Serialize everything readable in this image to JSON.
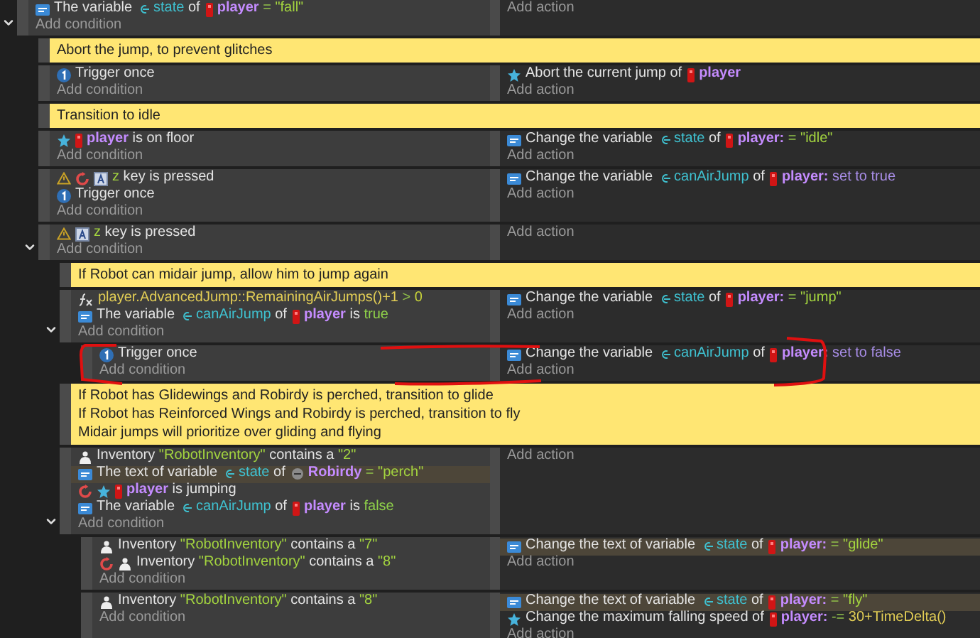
{
  "events": [
    {
      "kind": "event",
      "expanded": true,
      "add_condition": "Add condition",
      "add_action": "Add action",
      "conditions": [
        {
          "icons": [
            {
              "kind": "variable"
            }
          ],
          "highlighted": false,
          "segments": [
            {
              "kind": "text",
              "text": "The variable"
            },
            {
              "kind": "param",
              "text": "state"
            },
            {
              "kind": "text",
              "text": "of"
            },
            {
              "kind": "object",
              "text": "player"
            },
            {
              "kind": "operator",
              "text": "="
            },
            {
              "kind": "string",
              "text": "\"fall\""
            }
          ]
        }
      ],
      "children": [
        {
          "kind": "comment",
          "lines": [
            "Abort the jump, to prevent glitches"
          ]
        },
        {
          "kind": "event",
          "add_condition": "Add condition",
          "add_action": "Add action",
          "conditions": [
            {
              "icons": [
                {
                  "kind": "trigger"
                }
              ],
              "highlighted": false,
              "segments": [
                {
                  "kind": "text",
                  "text": "Trigger once"
                }
              ]
            }
          ],
          "actions": [
            {
              "icons": [
                {
                  "kind": "platformer"
                }
              ],
              "highlighted": false,
              "segments": [
                {
                  "kind": "text",
                  "text": "Abort the current jump of"
                },
                {
                  "kind": "object",
                  "text": "player"
                }
              ]
            }
          ]
        },
        {
          "kind": "comment",
          "lines": [
            "Transition to idle"
          ]
        },
        {
          "kind": "event",
          "add_condition": "Add condition",
          "add_action": "Add action",
          "conditions": [
            {
              "icons": [
                {
                  "kind": "platformer"
                }
              ],
              "highlighted": false,
              "segments": [
                {
                  "kind": "object",
                  "text": "player"
                },
                {
                  "kind": "text",
                  "text": "is on floor"
                }
              ]
            }
          ],
          "actions": [
            {
              "icons": [
                {
                  "kind": "variable"
                }
              ],
              "highlighted": false,
              "segments": [
                {
                  "kind": "text",
                  "text": "Change the variable"
                },
                {
                  "kind": "param",
                  "text": "state"
                },
                {
                  "kind": "text",
                  "text": "of"
                },
                {
                  "kind": "object",
                  "text": "player:"
                },
                {
                  "kind": "operator",
                  "text": "="
                },
                {
                  "kind": "string",
                  "text": "\"idle\""
                }
              ]
            }
          ]
        },
        {
          "kind": "event",
          "add_condition": "Add condition",
          "add_action": "Add action",
          "conditions": [
            {
              "icons": [
                {
                  "kind": "warning"
                },
                {
                  "kind": "inverted"
                },
                {
                  "kind": "keyboard"
                }
              ],
              "highlighted": false,
              "segments": [
                {
                  "kind": "string",
                  "text": "z"
                },
                {
                  "kind": "text",
                  "text": "key is pressed"
                }
              ]
            },
            {
              "icons": [
                {
                  "kind": "trigger"
                }
              ],
              "highlighted": false,
              "segments": [
                {
                  "kind": "text",
                  "text": "Trigger once"
                }
              ]
            }
          ],
          "actions": [
            {
              "icons": [
                {
                  "kind": "variable"
                }
              ],
              "highlighted": false,
              "segments": [
                {
                  "kind": "text",
                  "text": "Change the variable"
                },
                {
                  "kind": "param",
                  "text": "canAirJump"
                },
                {
                  "kind": "text",
                  "text": "of"
                },
                {
                  "kind": "object",
                  "text": "player:"
                },
                {
                  "kind": "keyword",
                  "text": "set to true"
                }
              ]
            }
          ]
        },
        {
          "kind": "event",
          "expanded": true,
          "add_condition": "Add condition",
          "add_action": "Add action",
          "conditions": [
            {
              "icons": [
                {
                  "kind": "warning"
                },
                {
                  "kind": "keyboard"
                }
              ],
              "highlighted": false,
              "segments": [
                {
                  "kind": "string",
                  "text": "z"
                },
                {
                  "kind": "text",
                  "text": "key is pressed"
                }
              ]
            }
          ],
          "children": [
            {
              "kind": "comment",
              "lines": [
                "If Robot can midair jump, allow him to jump again"
              ]
            },
            {
              "kind": "event",
              "expanded": true,
              "add_condition": "Add condition",
              "add_action": "Add action",
              "conditions": [
                {
                  "icons": [
                    {
                      "kind": "expression"
                    }
                  ],
                  "highlighted": false,
                  "segments": [
                    {
                      "kind": "expression",
                      "text": "player.AdvancedJump::RemainingAirJumps()+1"
                    },
                    {
                      "kind": "operator",
                      "text": ">"
                    },
                    {
                      "kind": "number",
                      "text": "0"
                    }
                  ]
                },
                {
                  "icons": [
                    {
                      "kind": "variable"
                    }
                  ],
                  "highlighted": false,
                  "segments": [
                    {
                      "kind": "text",
                      "text": "The variable"
                    },
                    {
                      "kind": "param",
                      "text": "canAirJump"
                    },
                    {
                      "kind": "text",
                      "text": "of"
                    },
                    {
                      "kind": "object",
                      "text": "player"
                    },
                    {
                      "kind": "text",
                      "text": "is"
                    },
                    {
                      "kind": "bool",
                      "text": "true"
                    }
                  ]
                }
              ],
              "actions": [
                {
                  "icons": [
                    {
                      "kind": "variable"
                    }
                  ],
                  "highlighted": false,
                  "segments": [
                    {
                      "kind": "text",
                      "text": "Change the variable"
                    },
                    {
                      "kind": "param",
                      "text": "state"
                    },
                    {
                      "kind": "text",
                      "text": "of"
                    },
                    {
                      "kind": "object",
                      "text": "player:"
                    },
                    {
                      "kind": "operator",
                      "text": "="
                    },
                    {
                      "kind": "string",
                      "text": "\"jump\""
                    }
                  ]
                }
              ],
              "children": [
                {
                  "kind": "event",
                  "add_condition": "Add condition",
                  "add_action": "Add action",
                  "conditions": [
                    {
                      "icons": [
                        {
                          "kind": "trigger"
                        }
                      ],
                      "highlighted": false,
                      "segments": [
                        {
                          "kind": "text",
                          "text": "Trigger once"
                        }
                      ]
                    }
                  ],
                  "actions": [
                    {
                      "icons": [
                        {
                          "kind": "variable"
                        }
                      ],
                      "highlighted": false,
                      "segments": [
                        {
                          "kind": "text",
                          "text": "Change the variable"
                        },
                        {
                          "kind": "param",
                          "text": "canAirJump"
                        },
                        {
                          "kind": "text",
                          "text": "of"
                        },
                        {
                          "kind": "object",
                          "text": "player:"
                        },
                        {
                          "kind": "keyword",
                          "text": "set to false"
                        }
                      ]
                    }
                  ]
                }
              ]
            },
            {
              "kind": "comment",
              "lines": [
                "If Robot has Glidewings and Robirdy is perched, transition to glide",
                "If Robot has Reinforced Wings and Robirdy is perched, transition to fly",
                "Midair jumps will prioritize over gliding and flying"
              ]
            },
            {
              "kind": "event",
              "expanded": true,
              "add_condition": "Add condition",
              "add_action": "Add action",
              "conditions": [
                {
                  "icons": [
                    {
                      "kind": "inventory"
                    }
                  ],
                  "highlighted": false,
                  "segments": [
                    {
                      "kind": "text",
                      "text": "Inventory"
                    },
                    {
                      "kind": "string",
                      "text": "\"RobotInventory\""
                    },
                    {
                      "kind": "text",
                      "text": "contains a"
                    },
                    {
                      "kind": "string",
                      "text": "\"2\""
                    }
                  ]
                },
                {
                  "icons": [
                    {
                      "kind": "variable"
                    }
                  ],
                  "highlighted": true,
                  "segments": [
                    {
                      "kind": "text",
                      "text": "The text of variable"
                    },
                    {
                      "kind": "param",
                      "text": "state"
                    },
                    {
                      "kind": "text",
                      "text": "of"
                    },
                    {
                      "kind": "object_alt",
                      "text": "Robirdy"
                    },
                    {
                      "kind": "operator",
                      "text": "="
                    },
                    {
                      "kind": "string",
                      "text": "\"perch\""
                    }
                  ]
                },
                {
                  "icons": [
                    {
                      "kind": "inverted"
                    },
                    {
                      "kind": "platformer"
                    }
                  ],
                  "highlighted": false,
                  "segments": [
                    {
                      "kind": "object",
                      "text": "player"
                    },
                    {
                      "kind": "text",
                      "text": "is jumping"
                    }
                  ]
                },
                {
                  "icons": [
                    {
                      "kind": "variable"
                    }
                  ],
                  "highlighted": false,
                  "segments": [
                    {
                      "kind": "text",
                      "text": "The variable"
                    },
                    {
                      "kind": "param",
                      "text": "canAirJump"
                    },
                    {
                      "kind": "text",
                      "text": "of"
                    },
                    {
                      "kind": "object",
                      "text": "player"
                    },
                    {
                      "kind": "text",
                      "text": "is"
                    },
                    {
                      "kind": "bool",
                      "text": "false"
                    }
                  ]
                }
              ],
              "children": [
                {
                  "kind": "event",
                  "add_condition": "Add condition",
                  "add_action": "Add action",
                  "conditions": [
                    {
                      "icons": [
                        {
                          "kind": "inventory"
                        }
                      ],
                      "highlighted": false,
                      "segments": [
                        {
                          "kind": "text",
                          "text": "Inventory"
                        },
                        {
                          "kind": "string",
                          "text": "\"RobotInventory\""
                        },
                        {
                          "kind": "text",
                          "text": "contains a"
                        },
                        {
                          "kind": "string",
                          "text": "\"7\""
                        }
                      ]
                    },
                    {
                      "icons": [
                        {
                          "kind": "inverted"
                        },
                        {
                          "kind": "inventory"
                        }
                      ],
                      "highlighted": false,
                      "segments": [
                        {
                          "kind": "text",
                          "text": "Inventory"
                        },
                        {
                          "kind": "string",
                          "text": "\"RobotInventory\""
                        },
                        {
                          "kind": "text",
                          "text": "contains a"
                        },
                        {
                          "kind": "string",
                          "text": "\"8\""
                        }
                      ]
                    }
                  ],
                  "actions": [
                    {
                      "icons": [
                        {
                          "kind": "variable"
                        }
                      ],
                      "highlighted": true,
                      "segments": [
                        {
                          "kind": "text",
                          "text": "Change the text of variable"
                        },
                        {
                          "kind": "param",
                          "text": "state"
                        },
                        {
                          "kind": "text",
                          "text": "of"
                        },
                        {
                          "kind": "object",
                          "text": "player:"
                        },
                        {
                          "kind": "operator",
                          "text": "="
                        },
                        {
                          "kind": "string",
                          "text": "\"glide\""
                        }
                      ]
                    }
                  ]
                },
                {
                  "kind": "event",
                  "add_condition": "Add condition",
                  "add_action": "Add action",
                  "conditions": [
                    {
                      "icons": [
                        {
                          "kind": "inventory"
                        }
                      ],
                      "highlighted": false,
                      "segments": [
                        {
                          "kind": "text",
                          "text": "Inventory"
                        },
                        {
                          "kind": "string",
                          "text": "\"RobotInventory\""
                        },
                        {
                          "kind": "text",
                          "text": "contains a"
                        },
                        {
                          "kind": "string",
                          "text": "\"8\""
                        }
                      ]
                    }
                  ],
                  "actions": [
                    {
                      "icons": [
                        {
                          "kind": "variable"
                        }
                      ],
                      "highlighted": true,
                      "segments": [
                        {
                          "kind": "text",
                          "text": "Change the text of variable"
                        },
                        {
                          "kind": "param",
                          "text": "state"
                        },
                        {
                          "kind": "text",
                          "text": "of"
                        },
                        {
                          "kind": "object",
                          "text": "player:"
                        },
                        {
                          "kind": "operator",
                          "text": "="
                        },
                        {
                          "kind": "string",
                          "text": "\"fly\""
                        }
                      ]
                    },
                    {
                      "icons": [
                        {
                          "kind": "platformer"
                        }
                      ],
                      "highlighted": false,
                      "segments": [
                        {
                          "kind": "text",
                          "text": "Change the maximum falling speed of"
                        },
                        {
                          "kind": "object",
                          "text": "player:"
                        },
                        {
                          "kind": "operator",
                          "text": "-="
                        },
                        {
                          "kind": "expression",
                          "text": "30+TimeDelta()"
                        }
                      ]
                    }
                  ]
                }
              ]
            }
          ]
        }
      ]
    }
  ]
}
